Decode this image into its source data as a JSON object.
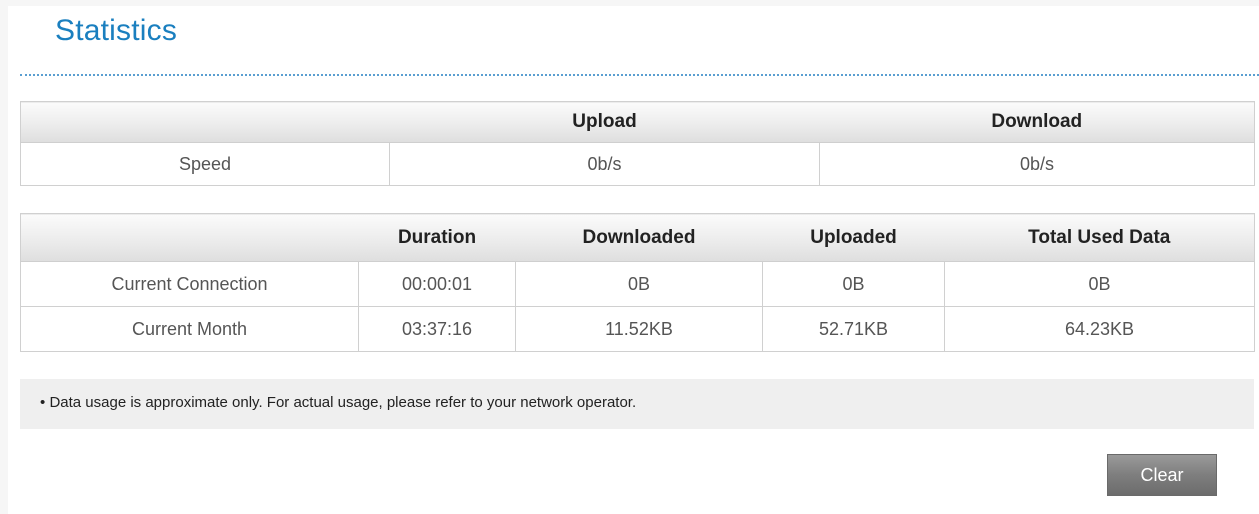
{
  "header": {
    "title": "Statistics"
  },
  "speed_table": {
    "columns": [
      "",
      "Upload",
      "Download"
    ],
    "row": {
      "label": "Speed",
      "upload": "0b/s",
      "download": "0b/s"
    }
  },
  "usage_table": {
    "columns": [
      "",
      "Duration",
      "Downloaded",
      "Uploaded",
      "Total Used Data"
    ],
    "rows": [
      {
        "label": "Current Connection",
        "duration": "00:00:01",
        "downloaded": "0B",
        "uploaded": "0B",
        "total": "0B"
      },
      {
        "label": "Current Month",
        "duration": "03:37:16",
        "downloaded": "11.52KB",
        "uploaded": "52.71KB",
        "total": "64.23KB"
      }
    ]
  },
  "note": {
    "bullet": "•",
    "text": "Data usage is approximate only. For actual usage, please refer to your network operator."
  },
  "actions": {
    "clear_label": "Clear"
  },
  "colors": {
    "title": "#1a7fbf",
    "rule": "#5a9fd1",
    "button": "#7e7e7e"
  }
}
